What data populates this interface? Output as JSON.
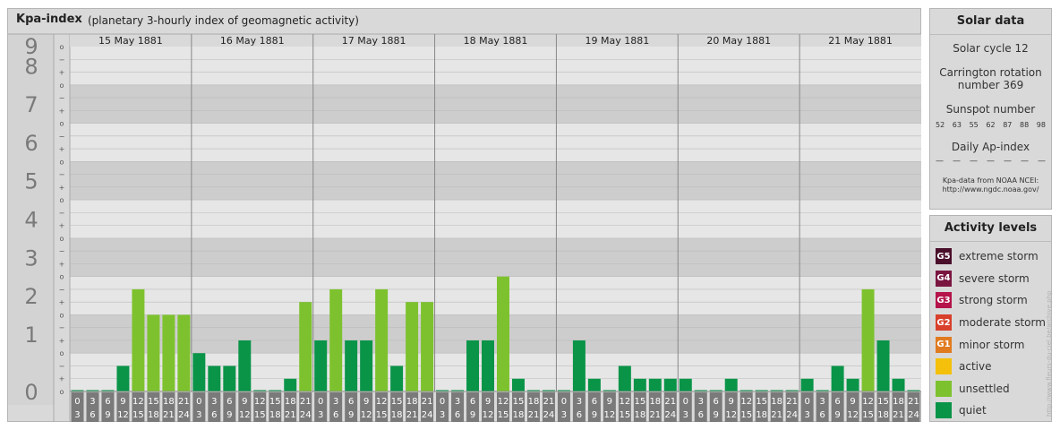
{
  "chart_data": {
    "type": "bar",
    "title": "Kpa-index",
    "subtitle": "(planetary 3-hourly index of geomagnetic activity)",
    "y_ticks": [
      "0",
      "1",
      "2",
      "3",
      "4",
      "5",
      "6",
      "7",
      "8",
      "9"
    ],
    "y_minor_labels": [
      "+",
      "o",
      "−"
    ],
    "ylim": [
      0,
      9
    ],
    "days": [
      "15 May 1881",
      "16 May 1881",
      "17 May 1881",
      "18 May 1881",
      "19 May 1881",
      "20 May 1881",
      "21 May 1881"
    ],
    "interval_start_labels": [
      "0",
      "3",
      "6",
      "9",
      "12",
      "15",
      "18",
      "21"
    ],
    "interval_end_labels": [
      "3",
      "6",
      "9",
      "12",
      "15",
      "18",
      "21",
      "24"
    ],
    "values": [
      [
        0,
        0,
        0,
        0.667,
        2.667,
        2,
        2,
        2
      ],
      [
        1,
        0.667,
        0.667,
        1.333,
        0,
        0,
        0.333,
        2.333
      ],
      [
        1.333,
        2.667,
        1.333,
        1.333,
        2.667,
        0.667,
        2.333,
        2.333
      ],
      [
        0,
        0,
        1.333,
        1.333,
        3,
        0.333,
        0,
        0
      ],
      [
        0,
        1.333,
        0.333,
        0,
        0.667,
        0.333,
        0.333,
        0.333
      ],
      [
        0.333,
        0,
        0,
        0.333,
        0,
        0,
        0,
        0
      ],
      [
        0.333,
        0,
        0.667,
        0.333,
        2.667,
        1.333,
        0.333,
        0
      ]
    ],
    "colors": {
      "quiet": "#0a9448",
      "unsettled": "#7dc22e",
      "active": "#f4c00b",
      "G1": "#e07b20",
      "G2": "#d8402b",
      "G3": "#b5134a",
      "G4": "#7a1540",
      "G5": "#4a0f2b"
    },
    "grid": true
  },
  "solar": {
    "title": "Solar data",
    "cycle": "Solar cycle 12",
    "carrington_1": "Carrington rotation",
    "carrington_2": "number 369",
    "sunspot_label": "Sunspot number",
    "sunspot_values": [
      "52",
      "63",
      "55",
      "62",
      "87",
      "88",
      "98"
    ],
    "ap_label": "Daily Ap-index",
    "ap_values": [
      "—",
      "—",
      "—",
      "—",
      "—",
      "—",
      "—"
    ],
    "source_1": "Kpa-data from NOAA NCEI:",
    "source_2": "http://www.ngdc.noaa.gov/"
  },
  "activity": {
    "title": "Activity levels",
    "items": [
      {
        "code": "G5",
        "label": "extreme storm",
        "color": "#4a0f2b"
      },
      {
        "code": "G4",
        "label": "severe storm",
        "color": "#7a1540"
      },
      {
        "code": "G3",
        "label": "strong storm",
        "color": "#b5134a"
      },
      {
        "code": "G2",
        "label": "moderate storm",
        "color": "#d8402b"
      },
      {
        "code": "G1",
        "label": "minor storm",
        "color": "#e07b20"
      },
      {
        "code": "",
        "label": "active",
        "color": "#f4c00b"
      },
      {
        "code": "",
        "label": "unsettled",
        "color": "#7dc22e"
      },
      {
        "code": "",
        "label": "quiet",
        "color": "#0a9448"
      }
    ]
  },
  "watermark": "http://www.fleurs-du-ciel.be/archive.php"
}
